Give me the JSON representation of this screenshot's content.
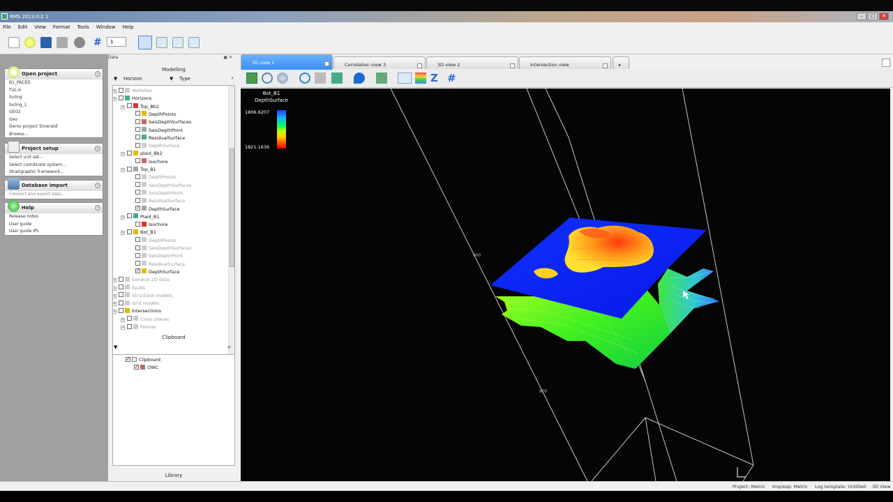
{
  "window": {
    "title": "RMS 2013.0.2 1"
  },
  "menu": [
    "File",
    "Edit",
    "View",
    "Format",
    "Tools",
    "Window",
    "Help"
  ],
  "toolbar": {
    "spinner_value": "1"
  },
  "tasks": {
    "open_project": {
      "title": "Open project",
      "items": [
        "B1_PACED",
        "TVL-6",
        "Suling",
        "Suling_1",
        "GEO2",
        "Geo",
        "Demo project 'Emerald'",
        "Browse..."
      ]
    },
    "project_setup": {
      "title": "Project setup",
      "items": [
        "Select unit set...",
        "Select coordinate system...",
        "Stratigraphic framework..."
      ]
    },
    "database_import": {
      "title": "Database import",
      "items": [
        "Connect and export data..."
      ]
    },
    "help": {
      "title": "Help",
      "items": [
        "Release notes",
        "User guide",
        "User guide IPL"
      ]
    }
  },
  "data_panel": {
    "title": "Data",
    "modelling_header": "Modelling",
    "filter_horizon": "Horizon",
    "filter_type": "Type",
    "clipboard_header": "Clipboard",
    "library_header": "Library",
    "tree": [
      {
        "label": "Wellsites",
        "level": 0,
        "grey": true
      },
      {
        "label": "Horizons",
        "level": 0
      },
      {
        "label": "Top_Bb2",
        "level": 1
      },
      {
        "label": "DepthPoints",
        "level": 2
      },
      {
        "label": "SeisDepthSurfaces",
        "level": 2
      },
      {
        "label": "SeisDepthPoint",
        "level": 2
      },
      {
        "label": "ResidualSurface",
        "level": 2
      },
      {
        "label": "DepthSurface",
        "level": 2,
        "grey": true
      },
      {
        "label": "plaid_Bb2",
        "level": 1
      },
      {
        "label": "Isochore",
        "level": 2
      },
      {
        "label": "Top_B1",
        "level": 1
      },
      {
        "label": "DepthPoints",
        "level": 2,
        "grey": true
      },
      {
        "label": "SeisDepthSurfaces",
        "level": 2,
        "grey": true
      },
      {
        "label": "SeisDepthPoint",
        "level": 2,
        "grey": true
      },
      {
        "label": "ResidualSurface",
        "level": 2,
        "grey": true
      },
      {
        "label": "DepthSurface",
        "level": 2,
        "checked": true
      },
      {
        "label": "Plaid_B1",
        "level": 1
      },
      {
        "label": "Isochore",
        "level": 2
      },
      {
        "label": "Bot_B1",
        "level": 1
      },
      {
        "label": "DepthPoints",
        "level": 2,
        "grey": true
      },
      {
        "label": "SeisDepthSurfaces",
        "level": 2,
        "grey": true
      },
      {
        "label": "SeisDepthPoint",
        "level": 2,
        "grey": true
      },
      {
        "label": "ResidualSurface",
        "level": 2,
        "grey": true
      },
      {
        "label": "DepthSurface",
        "level": 2,
        "checked": true
      },
      {
        "label": "General 2D data",
        "level": 0,
        "grey": true
      },
      {
        "label": "Faults",
        "level": 0,
        "grey": true
      },
      {
        "label": "Structural models",
        "level": 0,
        "grey": true
      },
      {
        "label": "Grid models",
        "level": 0,
        "grey": true
      },
      {
        "label": "Intersections",
        "level": 0
      },
      {
        "label": "Cross planes",
        "level": 1,
        "grey": true
      },
      {
        "label": "Fences",
        "level": 1,
        "grey": true
      }
    ],
    "clipboard": [
      {
        "label": "Clipboard",
        "level": 0
      },
      {
        "label": "OWC",
        "level": 1
      }
    ]
  },
  "view_tabs": [
    "3D view 1",
    "Correlation view 3",
    "3D view 2",
    "Intersection view"
  ],
  "viewport": {
    "legend_title_1": "Bot_B1",
    "legend_title_2": "DepthSurface",
    "legend_max": "1806.6207",
    "legend_min": "1821.1636",
    "box_label_1": "900",
    "box_label_2": "800"
  },
  "status": [
    "Project: Metric",
    "Imp/exp: Metric",
    "Log template: Untitled",
    "3D View"
  ]
}
